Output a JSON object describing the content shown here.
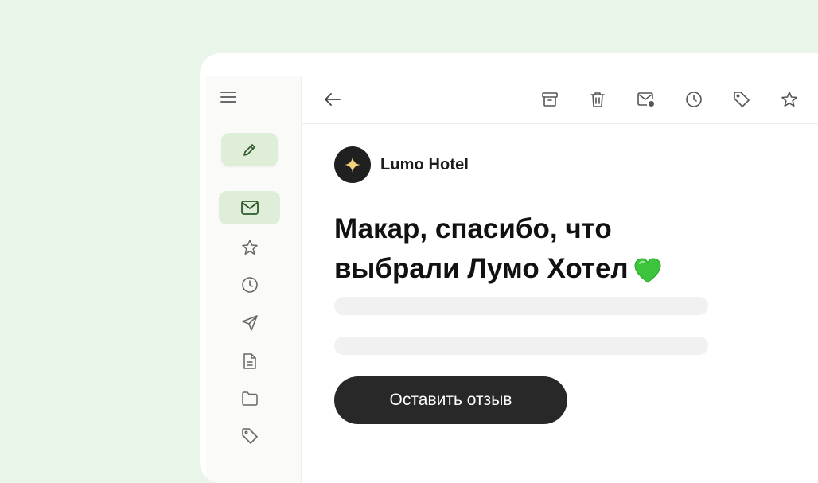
{
  "sidebar": {
    "menu_icon": "hamburger-menu-icon",
    "compose_icon": "pencil-icon",
    "items": [
      {
        "icon": "envelope-icon",
        "active": true
      },
      {
        "icon": "star-icon",
        "active": false
      },
      {
        "icon": "clock-icon",
        "active": false
      },
      {
        "icon": "send-icon",
        "active": false
      },
      {
        "icon": "document-icon",
        "active": false
      },
      {
        "icon": "folder-icon",
        "active": false
      },
      {
        "icon": "tag-icon",
        "active": false
      }
    ]
  },
  "toolbar": {
    "back_icon": "arrow-left-icon",
    "actions": [
      "archive-icon",
      "trash-icon",
      "mark-unread-icon",
      "snooze-clock-icon",
      "label-tag-icon",
      "star-icon"
    ]
  },
  "email": {
    "sender_name": "Lumo Hotel",
    "subject": "Макар, спасибо, что выбрали Лумо Хотел",
    "subject_emoji": "green-heart",
    "cta_label": "Оставить отзыв"
  },
  "colors": {
    "page_background": "#e8f5e8",
    "accent_green": "#dfeed8",
    "dark_button": "#282828",
    "avatar_star": "#f5d37a",
    "heart": "#3cc43c"
  }
}
